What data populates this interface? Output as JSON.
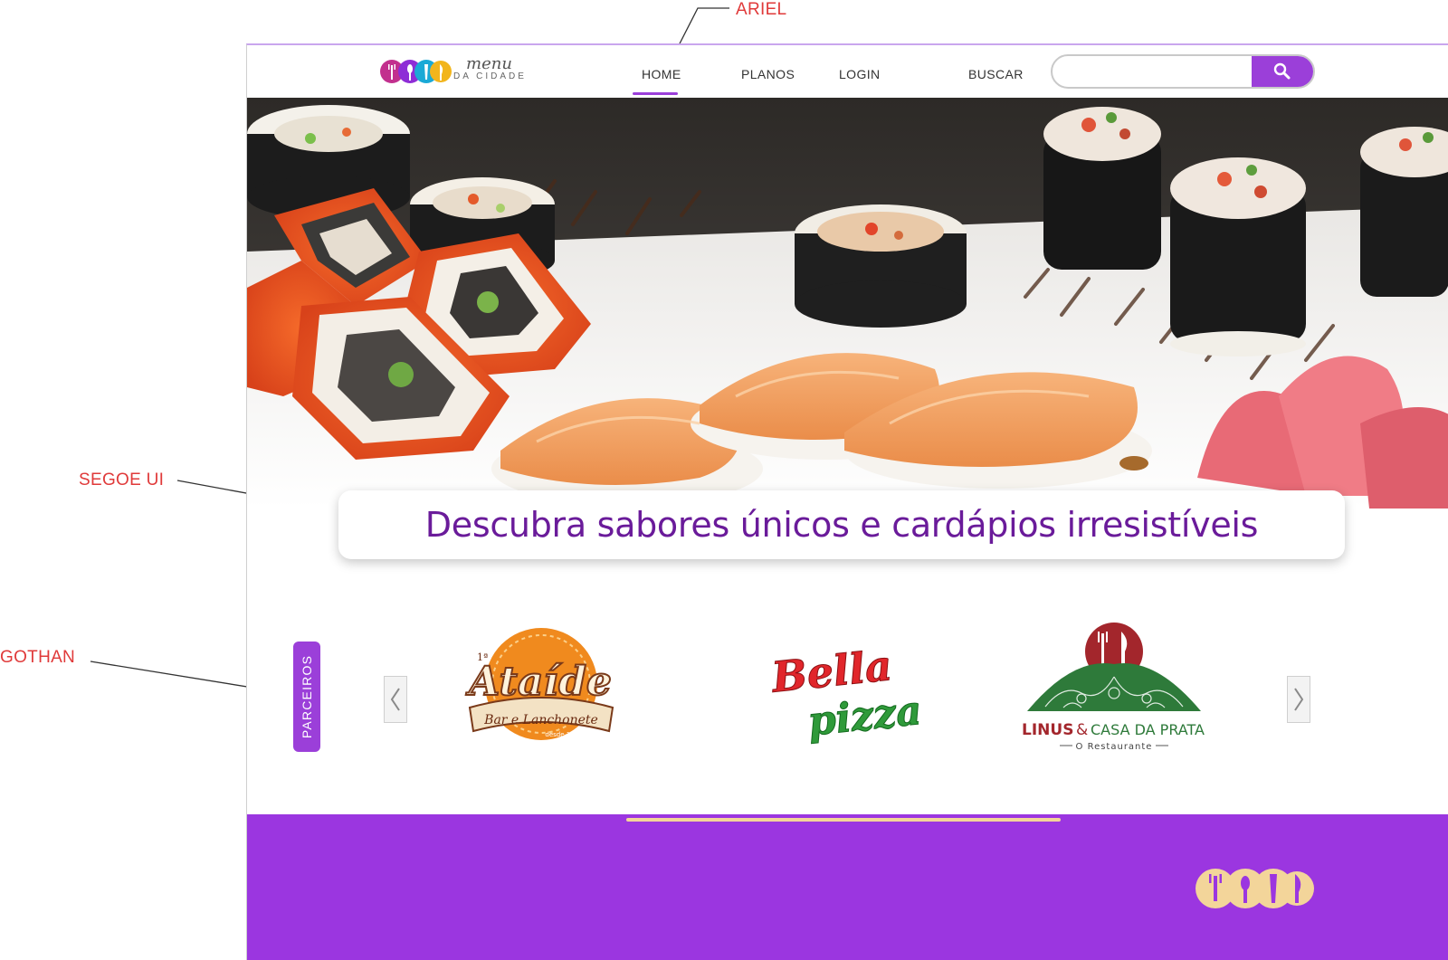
{
  "annotations": {
    "ariel": "ARIEL",
    "segoe": "SEGOE UI",
    "gothan": "GOTHAN"
  },
  "brand": {
    "logo_word": "menu",
    "logo_sub": "DA CIDADE",
    "colors": {
      "primary": "#9b3fd9",
      "headline": "#6a1b9a",
      "footer": "#9b36e0",
      "footer_accent": "#f3d59a",
      "logo_pink": "#c2308e",
      "logo_purple": "#8e2dd6",
      "logo_cyan": "#1aa9d6",
      "logo_yellow": "#f2b51c"
    }
  },
  "nav": {
    "home": "HOME",
    "planos": "PLANOS",
    "login": "LOGIN",
    "buscar": "BUSCAR",
    "active": "HOME"
  },
  "search": {
    "value": "",
    "placeholder": "",
    "icon": "search-icon"
  },
  "hero": {
    "image": "sushi-platter-photo",
    "headline": "Descubra sabores únicos e cardápios irresistíveis"
  },
  "partners": {
    "label": "PARCEIROS",
    "prev_icon": "chevron-left-icon",
    "next_icon": "chevron-right-icon",
    "items": [
      {
        "name": "Ataíde",
        "line2": "Bar e Lanchonete",
        "small_top": "1ª",
        "small_bottom": "desde 1952"
      },
      {
        "name1": "Bella",
        "name2": "pizza"
      },
      {
        "name1": "LINUS",
        "amp": "&",
        "name2": "CASA DA PRATA",
        "subtitle": "O Restaurante"
      }
    ]
  },
  "footer": {
    "logo": "menu-da-cidade-logo-icons"
  }
}
